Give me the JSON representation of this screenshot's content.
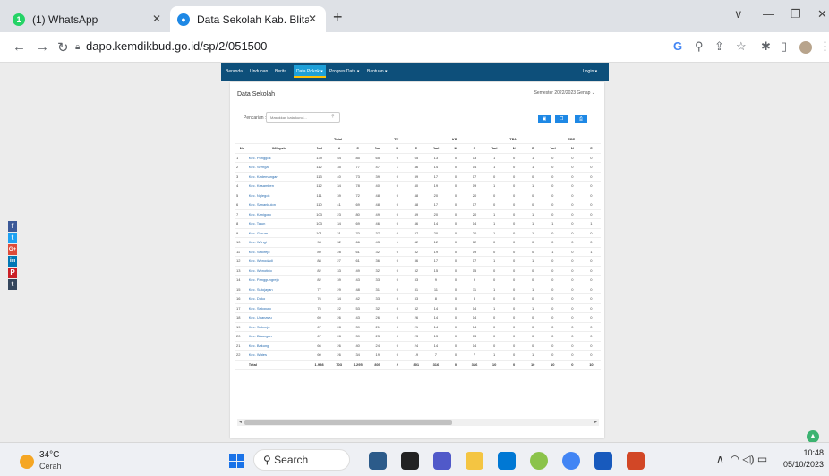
{
  "browser": {
    "tabs": [
      {
        "label": "(1) WhatsApp"
      },
      {
        "label": "Data Sekolah Kab. Blitar - Dapo"
      }
    ],
    "url": "dapo.kemdikbud.go.id/sp/2/051500"
  },
  "site": {
    "nav": [
      "Beranda",
      "Unduhan",
      "Berita",
      "Data Pokok ▾",
      "Progres Data ▾",
      "Bantuan ▾",
      "Login ▾"
    ],
    "title": "Data Sekolah",
    "semester": "Semester 2022/2023 Genap",
    "search_label": "Pencarian :",
    "search_placeholder": "Masukkan kata kunci...",
    "table": {
      "groups": [
        "Total",
        "TK",
        "KB",
        "TPA",
        "SPS"
      ],
      "col_no": "No",
      "col_wilayah": "Wilayah",
      "sub": [
        "Jml",
        "N",
        "S"
      ],
      "rows": [
        [
          "1",
          "Kec. Ponggok",
          "139",
          "54",
          "85",
          "65",
          "0",
          "65",
          "13",
          "0",
          "13",
          "1",
          "0",
          "1",
          "0",
          "0",
          "0"
        ],
        [
          "2",
          "Kec. Srengat",
          "112",
          "35",
          "77",
          "47",
          "1",
          "46",
          "14",
          "0",
          "14",
          "1",
          "0",
          "1",
          "0",
          "0",
          "0"
        ],
        [
          "3",
          "Kec. Kademangan",
          "113",
          "40",
          "73",
          "39",
          "0",
          "39",
          "17",
          "0",
          "17",
          "0",
          "0",
          "0",
          "0",
          "0",
          "0"
        ],
        [
          "4",
          "Kec. Kesamben",
          "112",
          "34",
          "78",
          "40",
          "0",
          "40",
          "19",
          "0",
          "19",
          "1",
          "0",
          "1",
          "0",
          "0",
          "0"
        ],
        [
          "5",
          "Kec. Nglegok",
          "111",
          "39",
          "72",
          "48",
          "0",
          "48",
          "20",
          "0",
          "20",
          "0",
          "0",
          "0",
          "0",
          "0",
          "0"
        ],
        [
          "6",
          "Kec. Sanankulon",
          "110",
          "41",
          "69",
          "48",
          "0",
          "48",
          "17",
          "0",
          "17",
          "0",
          "0",
          "0",
          "0",
          "0",
          "0"
        ],
        [
          "7",
          "Kec. Kanigoro",
          "103",
          "23",
          "80",
          "49",
          "0",
          "49",
          "20",
          "0",
          "20",
          "1",
          "0",
          "1",
          "0",
          "0",
          "0"
        ],
        [
          "8",
          "Kec. Talun",
          "103",
          "34",
          "69",
          "46",
          "0",
          "46",
          "14",
          "0",
          "14",
          "1",
          "0",
          "1",
          "1",
          "0",
          "1"
        ],
        [
          "9",
          "Kec. Garum",
          "101",
          "31",
          "70",
          "37",
          "0",
          "37",
          "20",
          "0",
          "20",
          "1",
          "0",
          "1",
          "0",
          "0",
          "0"
        ],
        [
          "10",
          "Kec. Wlingi",
          "98",
          "32",
          "66",
          "43",
          "1",
          "42",
          "12",
          "0",
          "12",
          "0",
          "0",
          "0",
          "0",
          "0",
          "0"
        ],
        [
          "11",
          "Kec. Selorejo",
          "89",
          "28",
          "61",
          "32",
          "0",
          "32",
          "19",
          "0",
          "19",
          "0",
          "0",
          "0",
          "1",
          "0",
          "1"
        ],
        [
          "12",
          "Kec. Wonodadi",
          "88",
          "27",
          "61",
          "36",
          "0",
          "36",
          "17",
          "0",
          "17",
          "1",
          "0",
          "1",
          "0",
          "0",
          "0"
        ],
        [
          "13",
          "Kec. Wonotirto",
          "82",
          "33",
          "49",
          "32",
          "0",
          "32",
          "15",
          "0",
          "15",
          "0",
          "0",
          "0",
          "0",
          "0",
          "0"
        ],
        [
          "14",
          "Kec. Panggungrejo",
          "82",
          "39",
          "43",
          "33",
          "0",
          "33",
          "9",
          "0",
          "9",
          "0",
          "0",
          "0",
          "0",
          "0",
          "0"
        ],
        [
          "15",
          "Kec. Sutojayan",
          "77",
          "29",
          "48",
          "31",
          "0",
          "31",
          "11",
          "0",
          "11",
          "1",
          "0",
          "1",
          "0",
          "0",
          "0"
        ],
        [
          "16",
          "Kec. Doko",
          "76",
          "34",
          "42",
          "33",
          "0",
          "33",
          "8",
          "0",
          "8",
          "0",
          "0",
          "0",
          "0",
          "0",
          "0"
        ],
        [
          "17",
          "Kec. Selopuro",
          "75",
          "22",
          "53",
          "32",
          "0",
          "32",
          "14",
          "0",
          "14",
          "1",
          "0",
          "1",
          "0",
          "0",
          "0"
        ],
        [
          "18",
          "Kec. Udanawu",
          "69",
          "26",
          "43",
          "26",
          "0",
          "26",
          "14",
          "0",
          "14",
          "0",
          "0",
          "0",
          "0",
          "0",
          "0"
        ],
        [
          "19",
          "Kec. Selorejo",
          "67",
          "28",
          "39",
          "21",
          "0",
          "21",
          "14",
          "0",
          "14",
          "0",
          "0",
          "0",
          "0",
          "0",
          "0"
        ],
        [
          "20",
          "Kec. Binangun",
          "67",
          "28",
          "39",
          "23",
          "0",
          "23",
          "13",
          "0",
          "13",
          "0",
          "0",
          "0",
          "0",
          "0",
          "0"
        ],
        [
          "21",
          "Kec. Bakung",
          "66",
          "26",
          "40",
          "24",
          "0",
          "24",
          "14",
          "0",
          "14",
          "0",
          "0",
          "0",
          "0",
          "0",
          "0"
        ],
        [
          "22",
          "Kec. Wates",
          "60",
          "26",
          "34",
          "19",
          "0",
          "19",
          "7",
          "0",
          "7",
          "1",
          "0",
          "1",
          "0",
          "0",
          "0"
        ]
      ],
      "total": [
        "Total",
        "1.998",
        "703",
        "1.295",
        "805",
        "2",
        "801",
        "316",
        "0",
        "316",
        "10",
        "0",
        "10",
        "10",
        "0",
        "10"
      ]
    }
  },
  "taskbar": {
    "temp": "34°C",
    "condition": "Cerah",
    "search": "Search",
    "time": "10:48",
    "date": "05/10/2023"
  },
  "colors": {
    "site_nav": "#0d4f7a",
    "accent": "#1e88e5",
    "link": "#2a6db0"
  }
}
